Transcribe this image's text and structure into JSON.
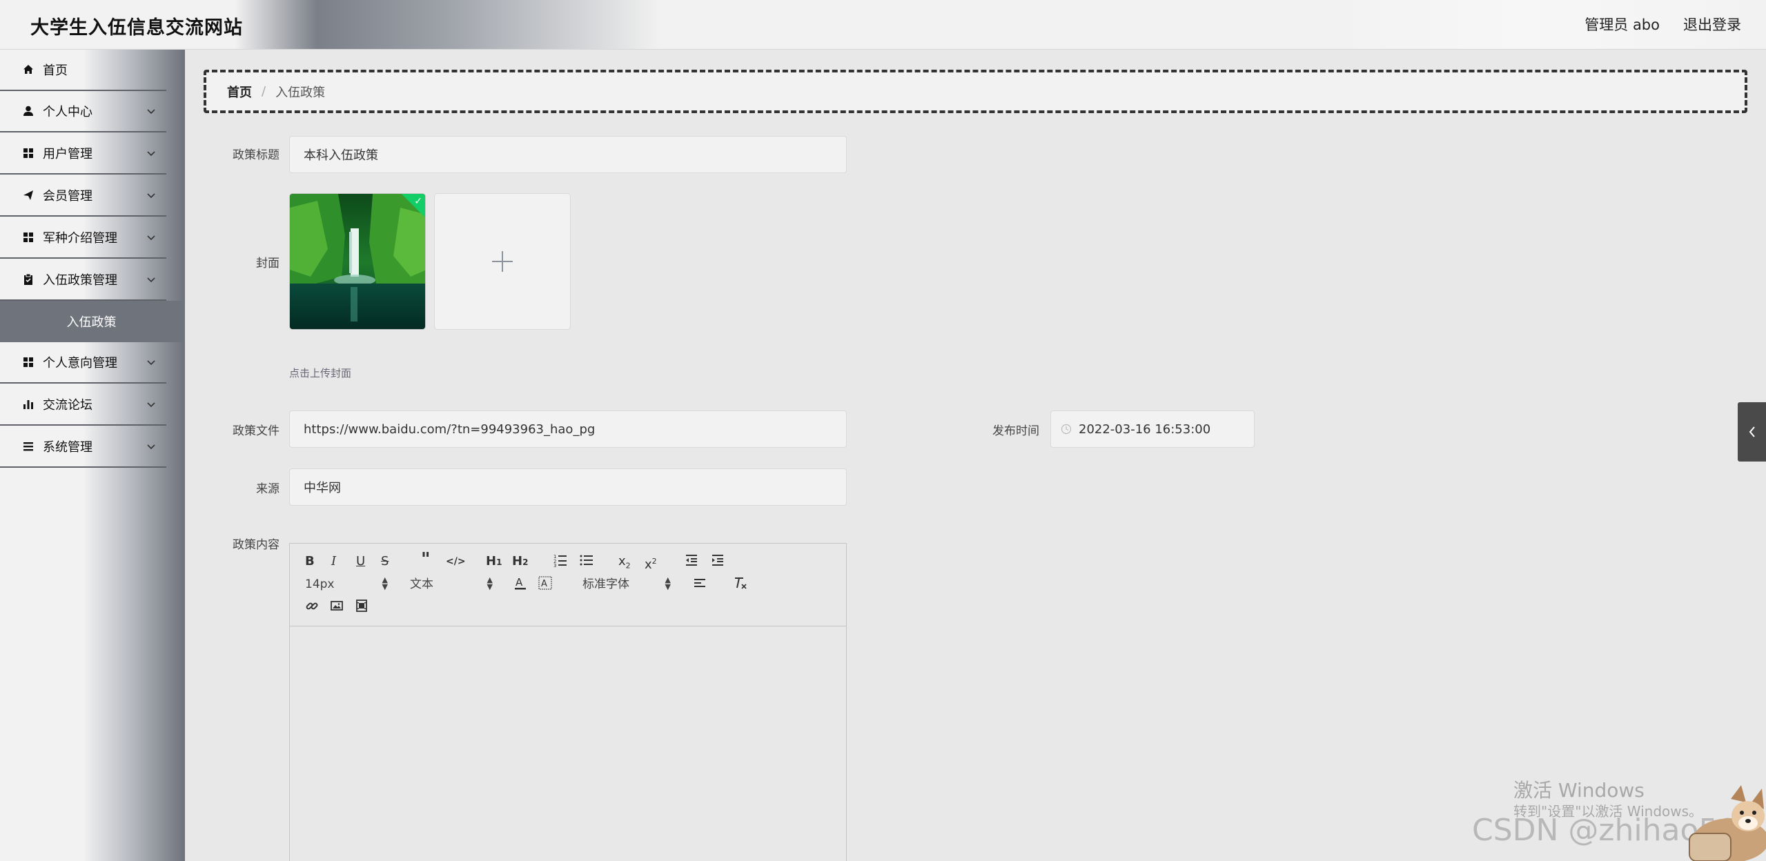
{
  "header": {
    "site_title": "大学生入伍信息交流网站",
    "user_label": "管理员 abo",
    "logout_label": "退出登录"
  },
  "sidebar": {
    "items": [
      {
        "label": "首页",
        "icon": "home-icon"
      },
      {
        "label": "个人中心",
        "icon": "user-icon"
      },
      {
        "label": "用户管理",
        "icon": "grid-icon"
      },
      {
        "label": "会员管理",
        "icon": "send-icon"
      },
      {
        "label": "军种介绍管理",
        "icon": "grid-icon"
      },
      {
        "label": "入伍政策管理",
        "icon": "clipboard-icon"
      },
      {
        "label": "个人意向管理",
        "icon": "grid-icon"
      },
      {
        "label": "交流论坛",
        "icon": "bar-chart-icon"
      },
      {
        "label": "系统管理",
        "icon": "list-icon"
      }
    ],
    "active_sub": "入伍政策"
  },
  "breadcrumb": {
    "home": "首页",
    "separator": "/",
    "current": "入伍政策"
  },
  "form": {
    "title_label": "政策标题",
    "title_value": "本科入伍政策",
    "cover_label": "封面",
    "cover_tip": "点击上传封面",
    "file_label": "政策文件",
    "file_value": "https://www.baidu.com/?tn=99493963_hao_pg",
    "publish_label": "发布时间",
    "publish_value": "2022-03-16 16:53:00",
    "source_label": "来源",
    "source_value": "中华网",
    "content_label": "政策内容"
  },
  "editor": {
    "font_size": "14px",
    "header_select": "文本",
    "font_family": "标准字体"
  },
  "watermark": {
    "activate_title": "激活 Windows",
    "activate_sub": "转到\"设置\"以激活 Windows。",
    "csdn": "CSDN @zhihao506"
  },
  "colors": {
    "success": "#13ce66",
    "active_menu": "#6f737b",
    "divider": "#5f6168"
  }
}
